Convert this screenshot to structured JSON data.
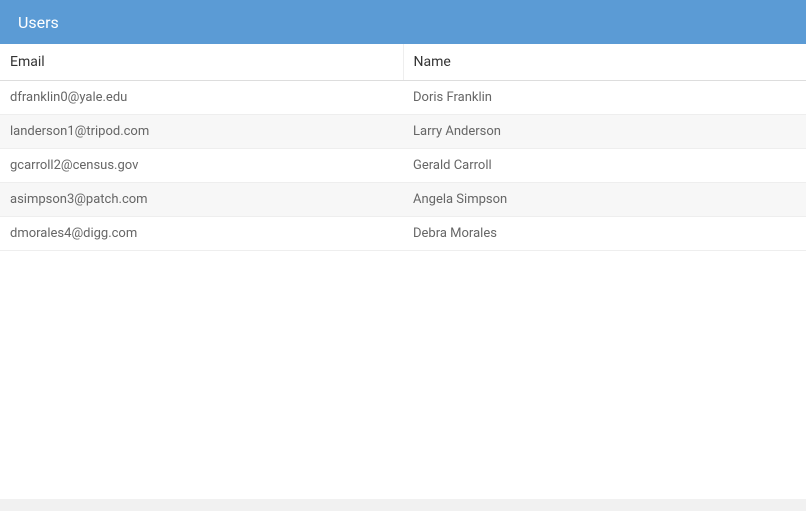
{
  "header": {
    "title": "Users"
  },
  "table": {
    "columns": [
      {
        "label": "Email"
      },
      {
        "label": "Name"
      }
    ],
    "rows": [
      {
        "email": "dfranklin0@yale.edu",
        "name": "Doris Franklin"
      },
      {
        "email": "landerson1@tripod.com",
        "name": "Larry Anderson"
      },
      {
        "email": "gcarroll2@census.gov",
        "name": "Gerald Carroll"
      },
      {
        "email": "asimpson3@patch.com",
        "name": "Angela Simpson"
      },
      {
        "email": "dmorales4@digg.com",
        "name": "Debra Morales"
      }
    ]
  }
}
